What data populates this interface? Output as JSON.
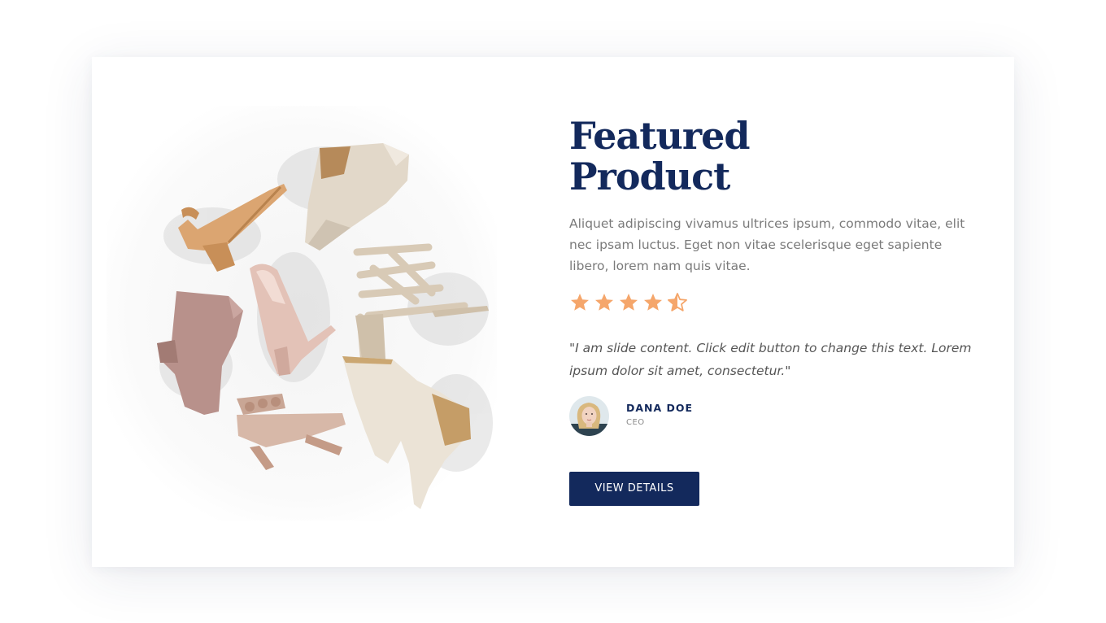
{
  "product": {
    "title_line1": "Featured",
    "title_line2": "Product",
    "description": "Aliquet adipiscing vivamus ultrices ipsum, commodo vitae, elit nec ipsam luctus. Eget non vitae scelerisque eget sapiente libero, lorem nam quis vitae.",
    "rating": 4.5,
    "rating_max": 5,
    "quote": "\"I am slide content. Click edit button to change this text. Lorem ipsum dolor sit amet, consectetur.\"",
    "button_label": "VIEW DETAILS"
  },
  "author": {
    "name": "DANA DOE",
    "role": "CEO",
    "avatar_icon": "woman-portrait"
  },
  "image": {
    "subject": "shoes-flatlay"
  },
  "colors": {
    "navy": "#13295c",
    "star": "#f5a66b",
    "text_gray": "#7a7a7a"
  }
}
